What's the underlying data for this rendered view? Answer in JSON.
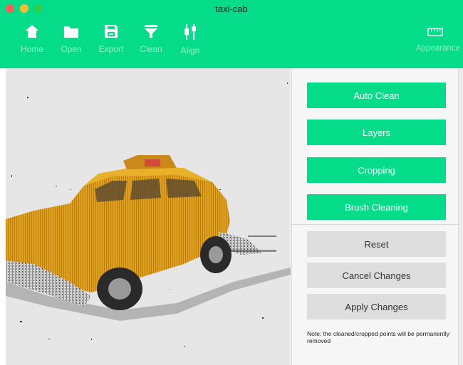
{
  "window": {
    "title": "taxi-cab"
  },
  "toolbar": {
    "items": [
      {
        "label": "Home",
        "icon": "home-icon"
      },
      {
        "label": "Open",
        "icon": "folder-icon"
      },
      {
        "label": "Export",
        "icon": "save-icon"
      },
      {
        "label": "Clean",
        "icon": "filter-icon"
      },
      {
        "label": "Align",
        "icon": "align-icon"
      },
      {
        "label": "Appearance",
        "icon": "ruler-icon"
      }
    ]
  },
  "panel": {
    "primary_buttons": [
      "Auto Clean",
      "Layers",
      "Cropping",
      "Brush Cleaning"
    ],
    "secondary_buttons": [
      "Reset",
      "Cancel Changes",
      "Apply Changes"
    ],
    "note": "Note: the cleaned/cropped points will be permanently removed"
  },
  "colors": {
    "accent": "#05DC8A",
    "viewport_bg": "#e6e6e6",
    "panel_bg": "#f6f6f6"
  }
}
